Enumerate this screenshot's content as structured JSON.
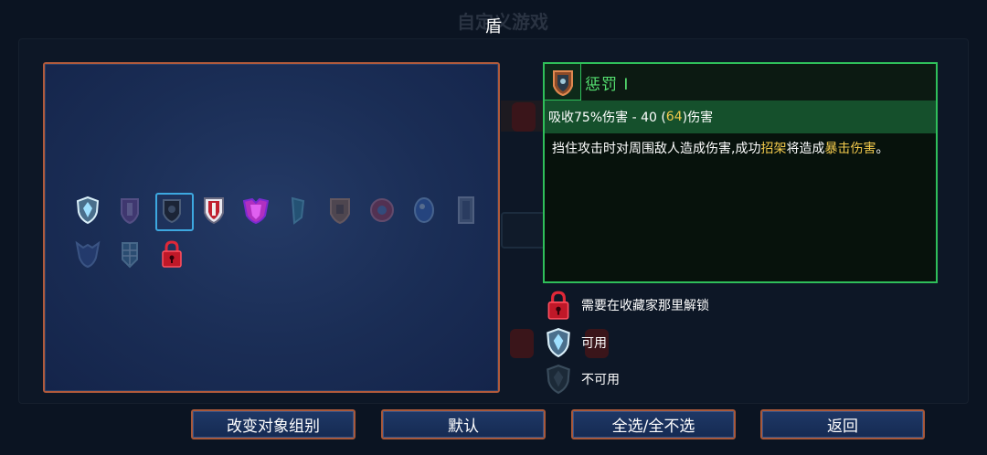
{
  "page": {
    "title": "盾",
    "background_title": "自定义游戏"
  },
  "grid": {
    "items": [
      {
        "icon": "crystal-shield-icon",
        "available": true,
        "selected": false
      },
      {
        "icon": "purple-shield-icon",
        "available": false,
        "selected": false
      },
      {
        "icon": "dark-shield-icon",
        "available": true,
        "selected": true
      },
      {
        "icon": "cross-shield-icon",
        "available": true,
        "selected": false
      },
      {
        "icon": "winged-magenta-shield-icon",
        "available": true,
        "selected": false
      },
      {
        "icon": "teal-shield-icon",
        "available": false,
        "selected": false
      },
      {
        "icon": "bronze-shield-icon",
        "available": false,
        "selected": false
      },
      {
        "icon": "round-red-shield-icon",
        "available": false,
        "selected": false
      },
      {
        "icon": "blue-orb-shield-icon",
        "available": false,
        "selected": false
      },
      {
        "icon": "tower-shield-icon",
        "available": false,
        "selected": false
      },
      {
        "icon": "horned-shield-icon",
        "available": false,
        "selected": false
      },
      {
        "icon": "grid-shield-icon",
        "available": false,
        "selected": false
      },
      {
        "icon": "lock-icon",
        "available": true,
        "selected": false
      }
    ]
  },
  "detail": {
    "icon": "punishment-shield-icon",
    "name": "惩罚 I",
    "stat_prefix": "吸收75%伤害 - 40 (",
    "stat_value": "64",
    "stat_suffix": ")伤害",
    "desc_part1": "挡住攻击时对周围敌人造成伤害,成功",
    "desc_highlight1": "招架",
    "desc_part2": "将造成",
    "desc_highlight2": "暴击伤害",
    "desc_part3": "。",
    "colors": {
      "border": "#2fbf5a",
      "name": "#55e070",
      "highlight": "#f2c94c"
    }
  },
  "legend": [
    {
      "icon": "lock-icon",
      "label": "需要在收藏家那里解锁"
    },
    {
      "icon": "available-shield-icon",
      "label": "可用"
    },
    {
      "icon": "unavailable-shield-icon",
      "label": "不可用"
    }
  ],
  "buttons": {
    "change_group": "改变对象组别",
    "default": "默认",
    "toggle_all": "全选/全不选",
    "back": "返回"
  }
}
